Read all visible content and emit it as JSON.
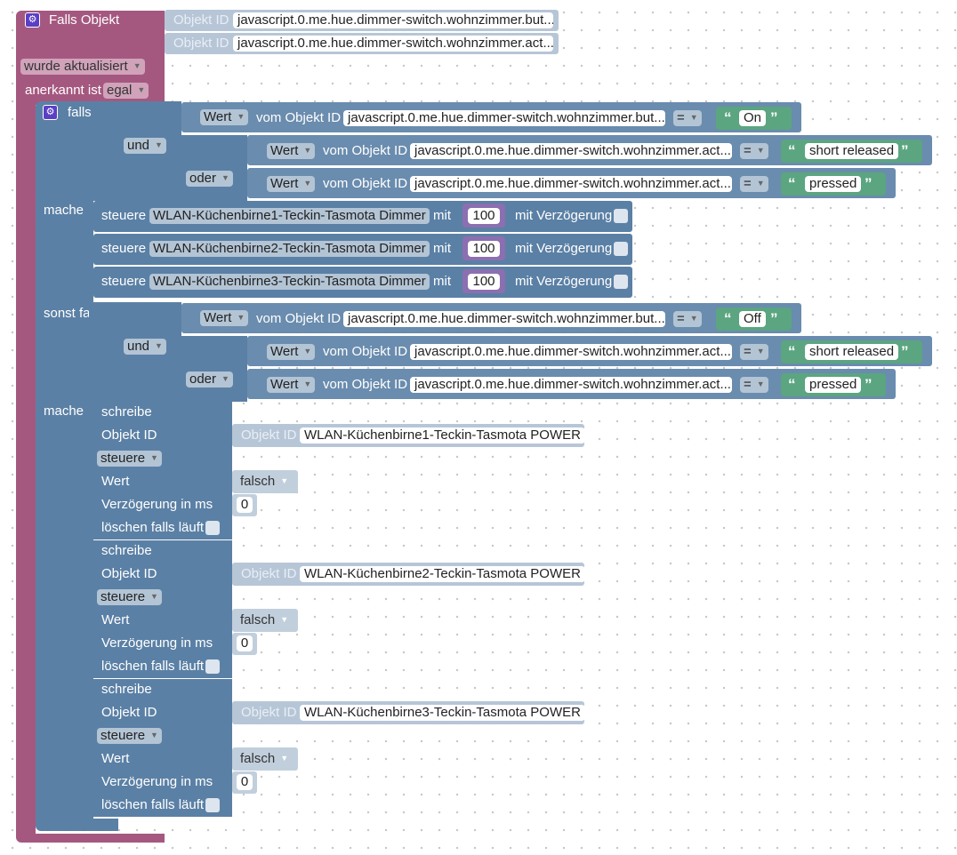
{
  "trigger": {
    "title": "Falls Objekt",
    "objekt_id_label": "Objekt ID",
    "objekt_id_1": "javascript.0.me.hue.dimmer-switch.wohnzimmer.but...",
    "objekt_id_2": "javascript.0.me.hue.dimmer-switch.wohnzimmer.act...",
    "wurde_aktualisiert": "wurde aktualisiert",
    "anerkannt_ist": "anerkannt ist",
    "egal": "egal"
  },
  "ifblock": {
    "falls": "falls",
    "mache": "mache",
    "sonst_falls": "sonst falls",
    "und": "und",
    "oder": "oder",
    "wert": "Wert",
    "vom_objekt_id": "vom Objekt ID",
    "eq": "=",
    "cond1_obj": "javascript.0.me.hue.dimmer-switch.wohnzimmer.but...",
    "cond_act_obj": "javascript.0.me.hue.dimmer-switch.wohnzimmer.act...",
    "val_on": "On",
    "val_off": "Off",
    "val_short_released": "short released",
    "val_pressed": "pressed",
    "open_quote": "“",
    "close_quote": "”"
  },
  "steuere_blocks": [
    {
      "steuere": "steuere",
      "device": "WLAN-Küchenbirne1-Teckin-Tasmota  Dimmer",
      "mit": "mit",
      "value": "100",
      "delay_label": "mit Verzögerung"
    },
    {
      "steuere": "steuere",
      "device": "WLAN-Küchenbirne2-Teckin-Tasmota  Dimmer",
      "mit": "mit",
      "value": "100",
      "delay_label": "mit Verzögerung"
    },
    {
      "steuere": "steuere",
      "device": "WLAN-Küchenbirne3-Teckin-Tasmota  Dimmer",
      "mit": "mit",
      "value": "100",
      "delay_label": "mit Verzögerung"
    }
  ],
  "schreibe_blocks": [
    {
      "schreibe": "schreibe",
      "objekt_id": "Objekt ID",
      "obj_label": "Objekt ID",
      "obj_value": "WLAN-Küchenbirne1-Teckin-Tasmota POWER",
      "mode": "steuere",
      "wert": "Wert",
      "wert_value": "falsch",
      "delay_label": "Verzögerung in ms",
      "delay_value": "0",
      "loeschen": "löschen falls läuft"
    },
    {
      "schreibe": "schreibe",
      "objekt_id": "Objekt ID",
      "obj_label": "Objekt ID",
      "obj_value": "WLAN-Küchenbirne2-Teckin-Tasmota POWER",
      "mode": "steuere",
      "wert": "Wert",
      "wert_value": "falsch",
      "delay_label": "Verzögerung in ms",
      "delay_value": "0",
      "loeschen": "löschen falls läuft"
    },
    {
      "schreibe": "schreibe",
      "objekt_id": "Objekt ID",
      "obj_label": "Objekt ID",
      "obj_value": "WLAN-Küchenbirne3-Teckin-Tasmota POWER",
      "mode": "steuere",
      "wert": "Wert",
      "wert_value": "falsch",
      "delay_label": "Verzögerung in ms",
      "delay_value": "0",
      "loeschen": "löschen falls läuft"
    }
  ],
  "icons": {
    "gear": "gear-icon",
    "dropdown": "chevron-down-icon",
    "checkbox": "checkbox-icon"
  },
  "colors": {
    "trigger": "#a5587f",
    "logic": "#5b80a5",
    "text": "#5ba580",
    "value": "#b7c6d7",
    "number": "#8c6fb0"
  }
}
